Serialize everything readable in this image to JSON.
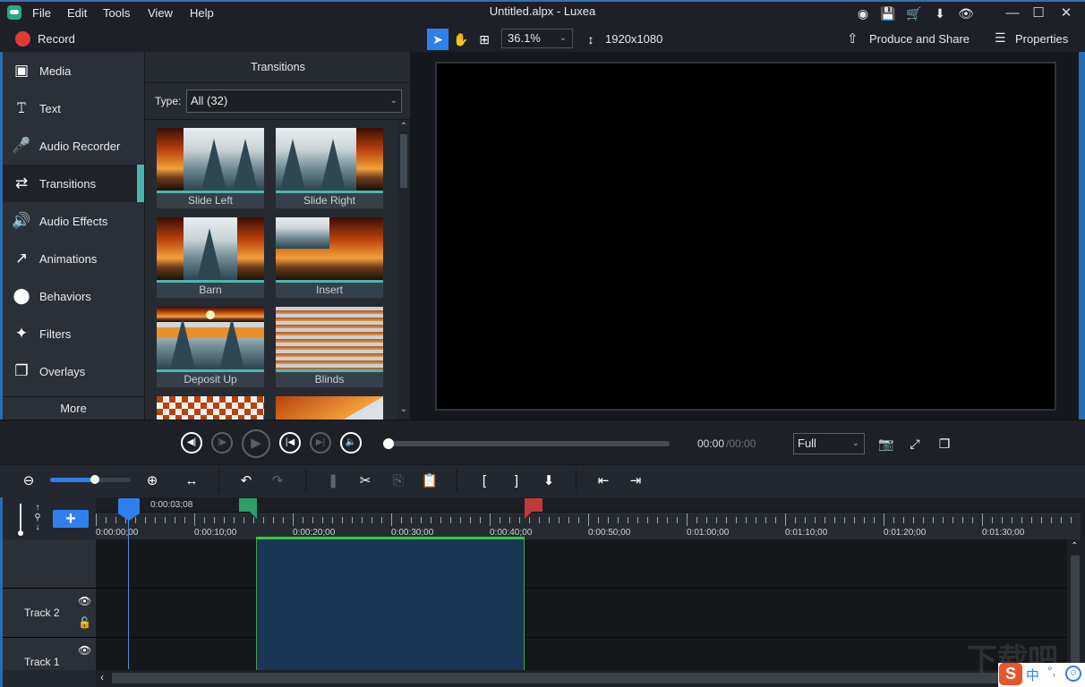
{
  "app": {
    "title": "Untitled.alpx - Luxea",
    "menu": [
      "File",
      "Edit",
      "Tools",
      "View",
      "Help"
    ]
  },
  "titlebar_icons": [
    "account-icon",
    "save-icon",
    "cart-icon",
    "download-icon",
    "eye-icon"
  ],
  "toolbar": {
    "record_label": "Record",
    "zoom_value": "36.1%",
    "resolution": "1920x1080",
    "produce_label": "Produce and Share",
    "properties_label": "Properties"
  },
  "sidebar": {
    "items": [
      {
        "label": "Media",
        "icon": "media-icon"
      },
      {
        "label": "Text",
        "icon": "text-icon"
      },
      {
        "label": "Audio Recorder",
        "icon": "microphone-icon"
      },
      {
        "label": "Transitions",
        "icon": "transitions-icon",
        "active": true
      },
      {
        "label": "Audio Effects",
        "icon": "speaker-icon"
      },
      {
        "label": "Animations",
        "icon": "arrow-icon"
      },
      {
        "label": "Behaviors",
        "icon": "behaviors-icon"
      },
      {
        "label": "Filters",
        "icon": "magic-wand-icon"
      },
      {
        "label": "Overlays",
        "icon": "overlays-icon"
      }
    ],
    "more_label": "More"
  },
  "transitions": {
    "title": "Transitions",
    "type_label": "Type:",
    "type_value": "All (32)",
    "items": [
      {
        "label": "Slide Left"
      },
      {
        "label": "Slide Right"
      },
      {
        "label": "Barn"
      },
      {
        "label": "Insert"
      },
      {
        "label": "Deposit Up"
      },
      {
        "label": "Blinds"
      },
      {
        "label": ""
      },
      {
        "label": ""
      }
    ]
  },
  "playback": {
    "time_current": "00:00",
    "time_total": "/00:00",
    "progress": 0,
    "fit_value": "Full"
  },
  "timeline": {
    "zoom_level": 0.55,
    "playhead_time": "0:00:03;08",
    "ruler_labels": [
      "0:00:00;00",
      "0:00:10;00",
      "0:00:20;00",
      "0:00:30;00",
      "0:00:40;00",
      "0:00:50;00",
      "0:01:00;00",
      "0:01:10;00",
      "0:01:20;00",
      "0:01:30;00"
    ],
    "tracks": [
      {
        "label": "Track 2"
      },
      {
        "label": "Track 1"
      }
    ]
  },
  "ime": {
    "logo": "S",
    "lang": "中",
    "punct": "°,"
  },
  "watermark": "下载吧"
}
